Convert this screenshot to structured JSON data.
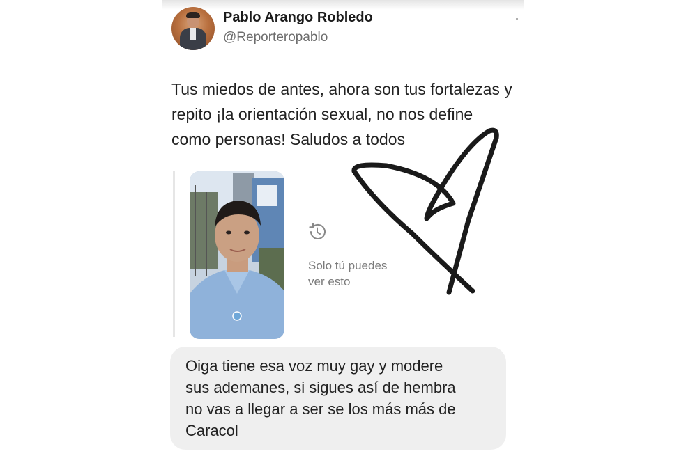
{
  "post": {
    "author_name": "Pablo Arango Robledo",
    "handle": "@Reporteropablo",
    "text_lines": [
      "Tus miedos de antes, ahora son tus fortalezas y",
      "repito ¡la orientación sexual, no nos define",
      "como personas! Saludos a todos"
    ]
  },
  "story": {
    "visibility_line1": "Solo tú puedes",
    "visibility_line2": "ver esto",
    "icon": "history-icon"
  },
  "reply": {
    "text_lines": [
      "Oiga tiene esa voz muy gay y modere",
      "sus ademanes, si sigues así de hembra",
      "no vas a llegar a ser se los más más de",
      "Caracol"
    ]
  },
  "colors": {
    "text": "#222222",
    "muted": "#6d6d6d",
    "bubble": "#efefef",
    "ink": "#1a1a1a"
  }
}
